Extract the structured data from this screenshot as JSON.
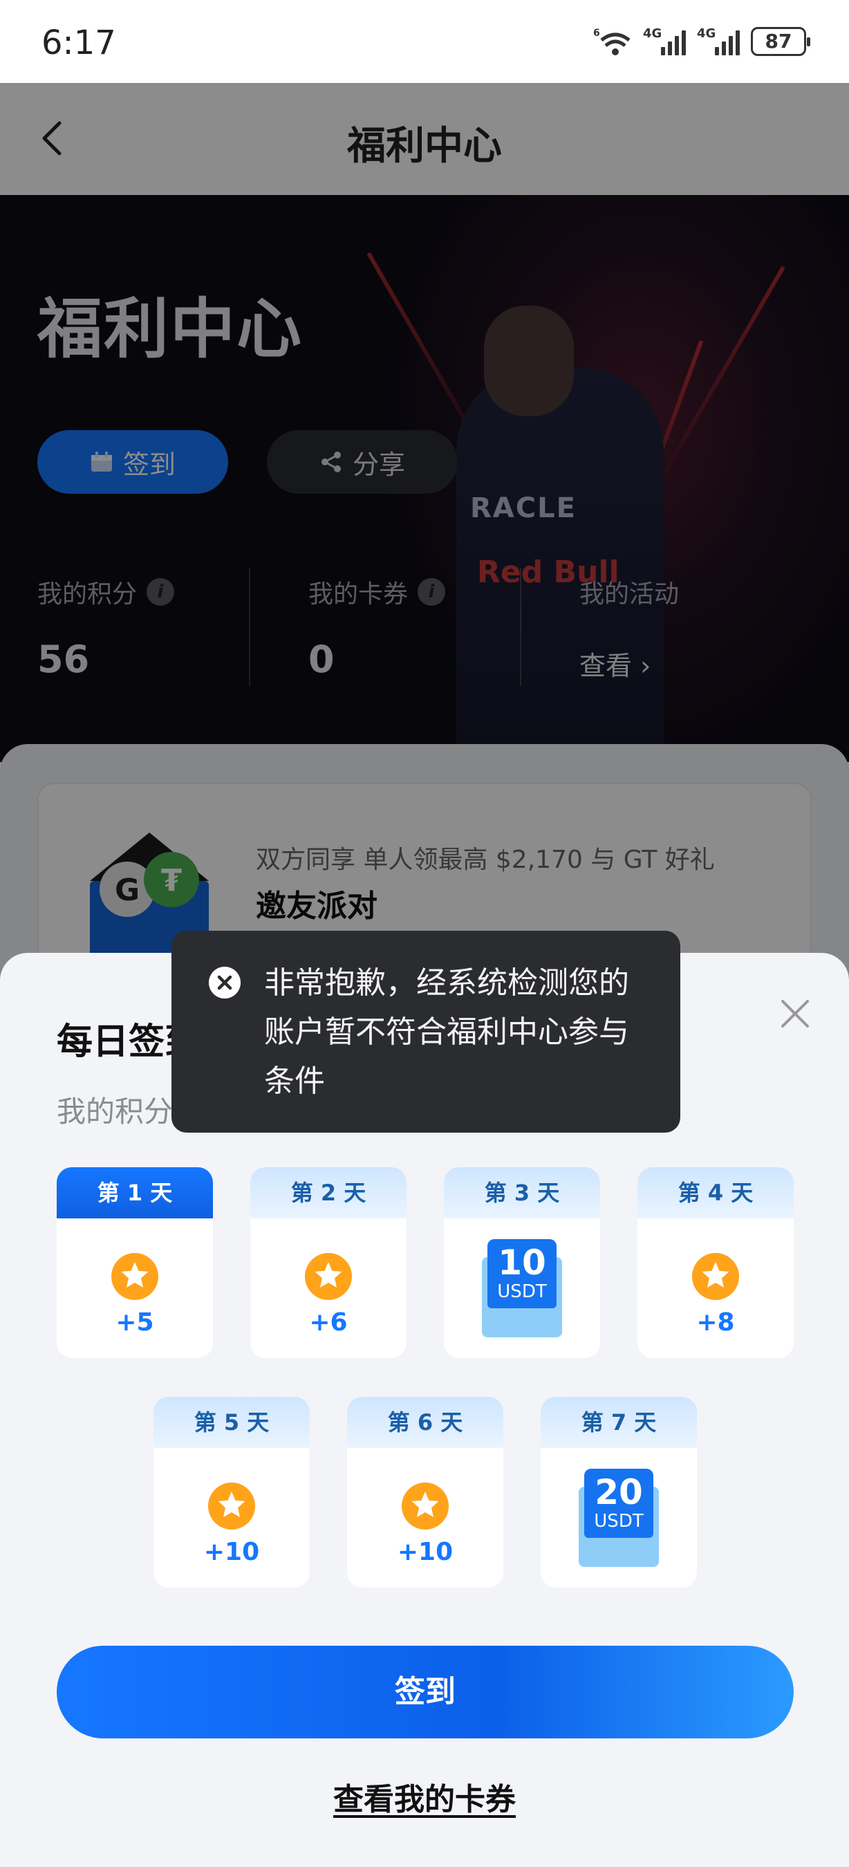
{
  "status_bar": {
    "time": "6:17",
    "battery": "87",
    "net1": "4G",
    "net2": "4G",
    "wifi_tag": "6"
  },
  "header": {
    "title": "福利中心"
  },
  "hero": {
    "title": "福利中心",
    "sign_label": "签到",
    "share_label": "分享",
    "points_label": "我的积分",
    "points_value": "56",
    "coupons_label": "我的卡券",
    "coupons_value": "0",
    "activities_label": "我的活动",
    "activities_link": "查看 ›",
    "person_text_1": "RACLE",
    "person_text_2": "Red Bull"
  },
  "promo": {
    "subtitle": "双方同享 单人领最高 $2,170 与 GT 好礼",
    "title": "邀友派对"
  },
  "sheet": {
    "title": "每日签到",
    "subtitle": "我的积分",
    "days": [
      {
        "label": "第 1 天",
        "reward": "+5"
      },
      {
        "label": "第 2 天",
        "reward": "+6"
      },
      {
        "label": "第 3 天",
        "amount": "10",
        "unit": "USDT"
      },
      {
        "label": "第 4 天",
        "reward": "+8"
      },
      {
        "label": "第 5 天",
        "reward": "+10"
      },
      {
        "label": "第 6 天",
        "reward": "+10"
      },
      {
        "label": "第 7 天",
        "amount": "20",
        "unit": "USDT"
      }
    ],
    "sign_button": "签到",
    "coupon_link": "查看我的卡券"
  },
  "toast": {
    "message": "非常抱歉，经系统检测您的账户暂不符合福利中心参与条件"
  },
  "colors": {
    "accent": "#1677ff",
    "coin": "#ffa31a",
    "toast_bg": "#2b2c30"
  }
}
